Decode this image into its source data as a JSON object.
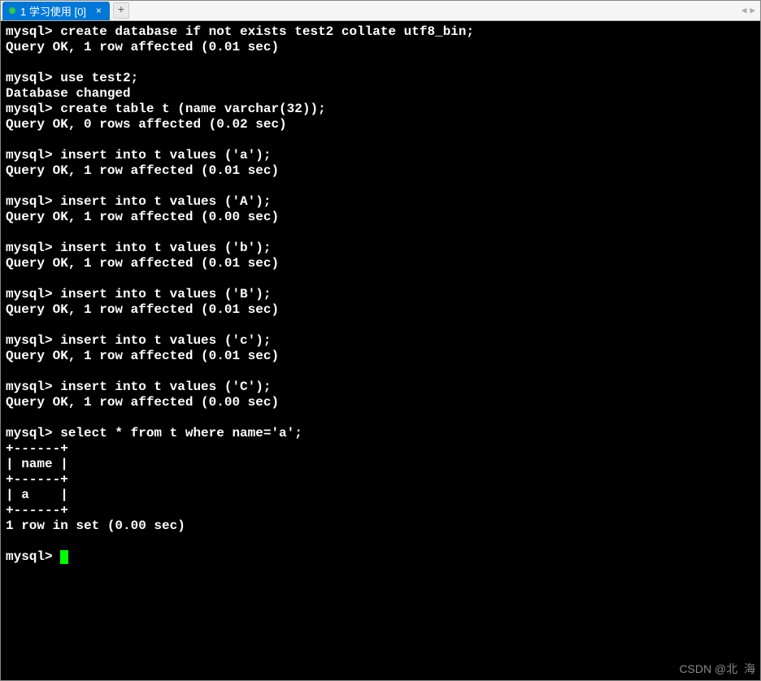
{
  "tabs": {
    "active": {
      "title": "1 学习使用 [0]"
    },
    "newTab": "+"
  },
  "terminal": {
    "lines": [
      "mysql> create database if not exists test2 collate utf8_bin;",
      "Query OK, 1 row affected (0.01 sec)",
      "",
      "mysql> use test2;",
      "Database changed",
      "mysql> create table t (name varchar(32));",
      "Query OK, 0 rows affected (0.02 sec)",
      "",
      "mysql> insert into t values ('a');",
      "Query OK, 1 row affected (0.01 sec)",
      "",
      "mysql> insert into t values ('A');",
      "Query OK, 1 row affected (0.00 sec)",
      "",
      "mysql> insert into t values ('b');",
      "Query OK, 1 row affected (0.01 sec)",
      "",
      "mysql> insert into t values ('B');",
      "Query OK, 1 row affected (0.01 sec)",
      "",
      "mysql> insert into t values ('c');",
      "Query OK, 1 row affected (0.01 sec)",
      "",
      "mysql> insert into t values ('C');",
      "Query OK, 1 row affected (0.00 sec)",
      "",
      "mysql> select * from t where name='a';",
      "+------+",
      "| name |",
      "+------+",
      "| a    |",
      "+------+",
      "1 row in set (0.00 sec)",
      "",
      "mysql> "
    ]
  },
  "watermark": "CSDN @北  海"
}
